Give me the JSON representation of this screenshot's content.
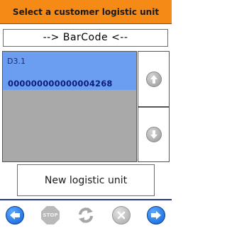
{
  "header": {
    "title": "Select a customer logistic unit"
  },
  "barcode": {
    "text": "--> BarCode <--"
  },
  "list": {
    "items": [
      {
        "code": "D3.1",
        "barcode": "000000000000004268",
        "selected": true
      }
    ]
  },
  "actions": {
    "new_unit_label": "New logistic unit"
  },
  "toolbar": {
    "stop_label": "STOP"
  },
  "colors": {
    "title_bar": "#f58a17",
    "selected_row": "#6b9ef0",
    "list_background": "#a9a9a9",
    "toolbar_border": "#223a8c",
    "nav_blue": "#1263d8"
  },
  "icons": {
    "scroll_up": "arrow-up-icon",
    "scroll_down": "arrow-down-icon",
    "back": "arrow-left-icon",
    "stop": "stop-icon",
    "refresh": "refresh-icon",
    "cancel": "close-icon",
    "next": "arrow-right-icon"
  }
}
